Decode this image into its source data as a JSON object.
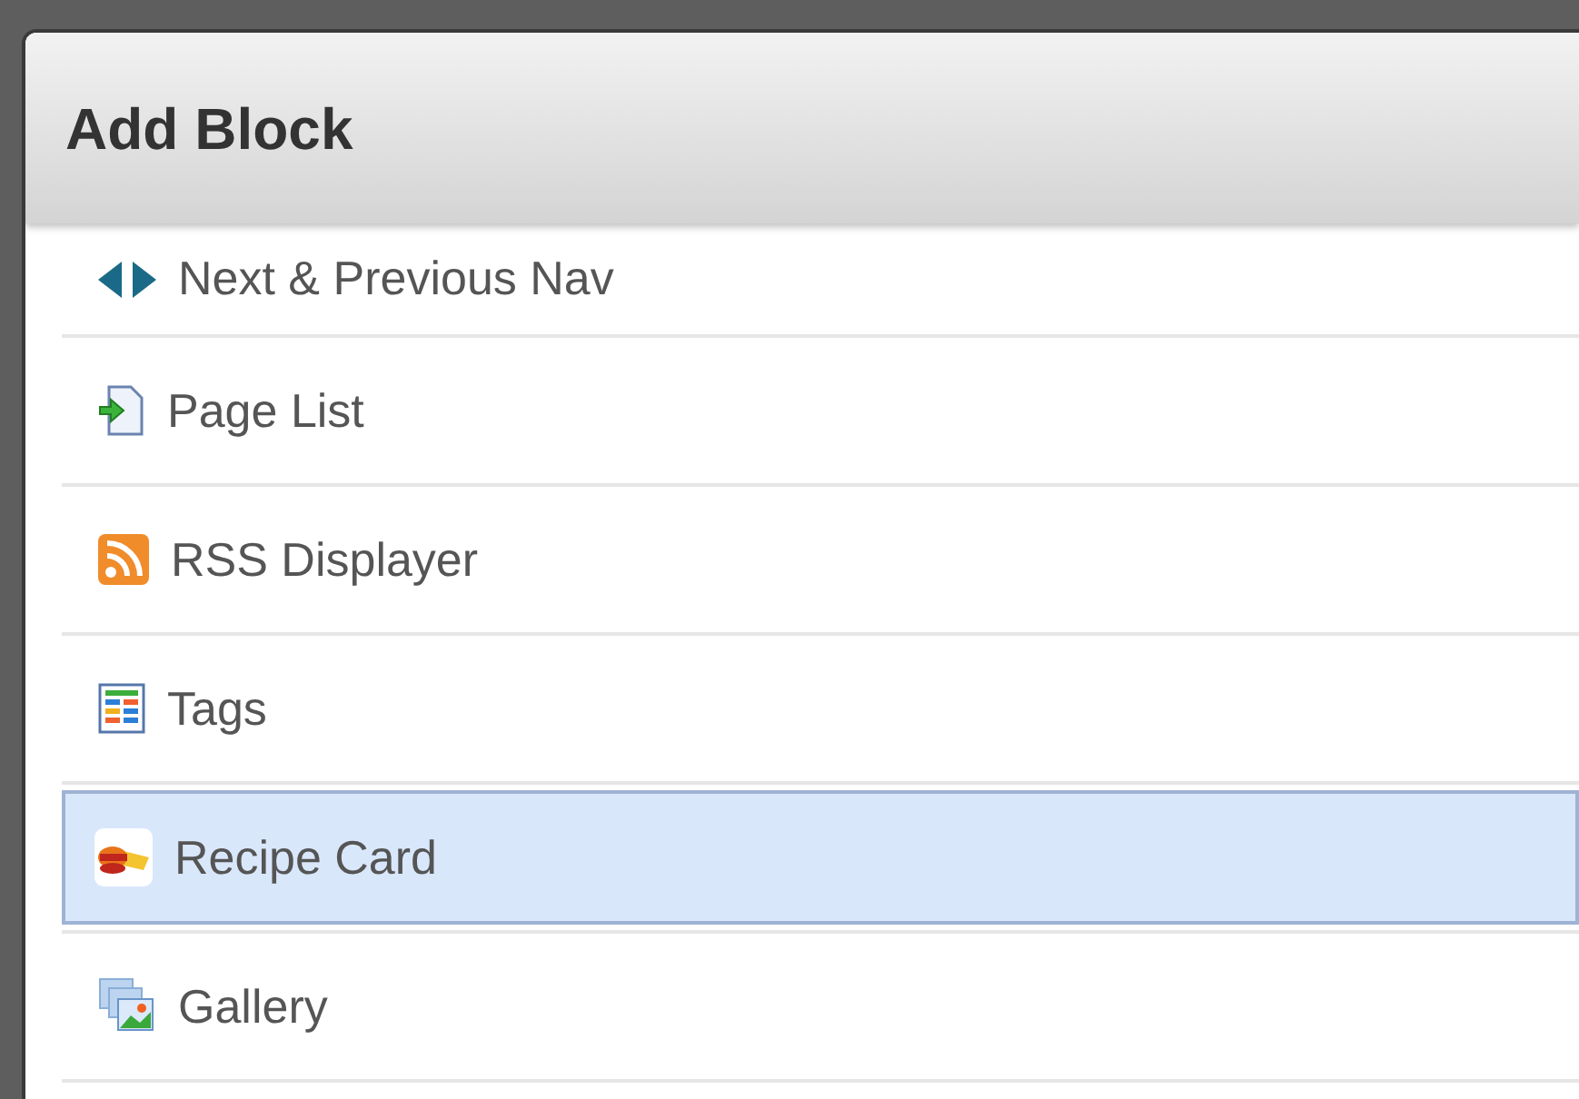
{
  "dialog": {
    "title": "Add Block"
  },
  "items": [
    {
      "kind": "nav",
      "label": "Next & Previous Nav",
      "selected": false
    },
    {
      "kind": "page-list",
      "label": "Page List",
      "selected": false
    },
    {
      "kind": "rss",
      "label": "RSS Displayer",
      "selected": false
    },
    {
      "kind": "tags",
      "label": "Tags",
      "selected": false
    },
    {
      "kind": "recipe",
      "label": "Recipe Card",
      "selected": true
    },
    {
      "kind": "gallery",
      "label": "Gallery",
      "selected": false
    }
  ]
}
